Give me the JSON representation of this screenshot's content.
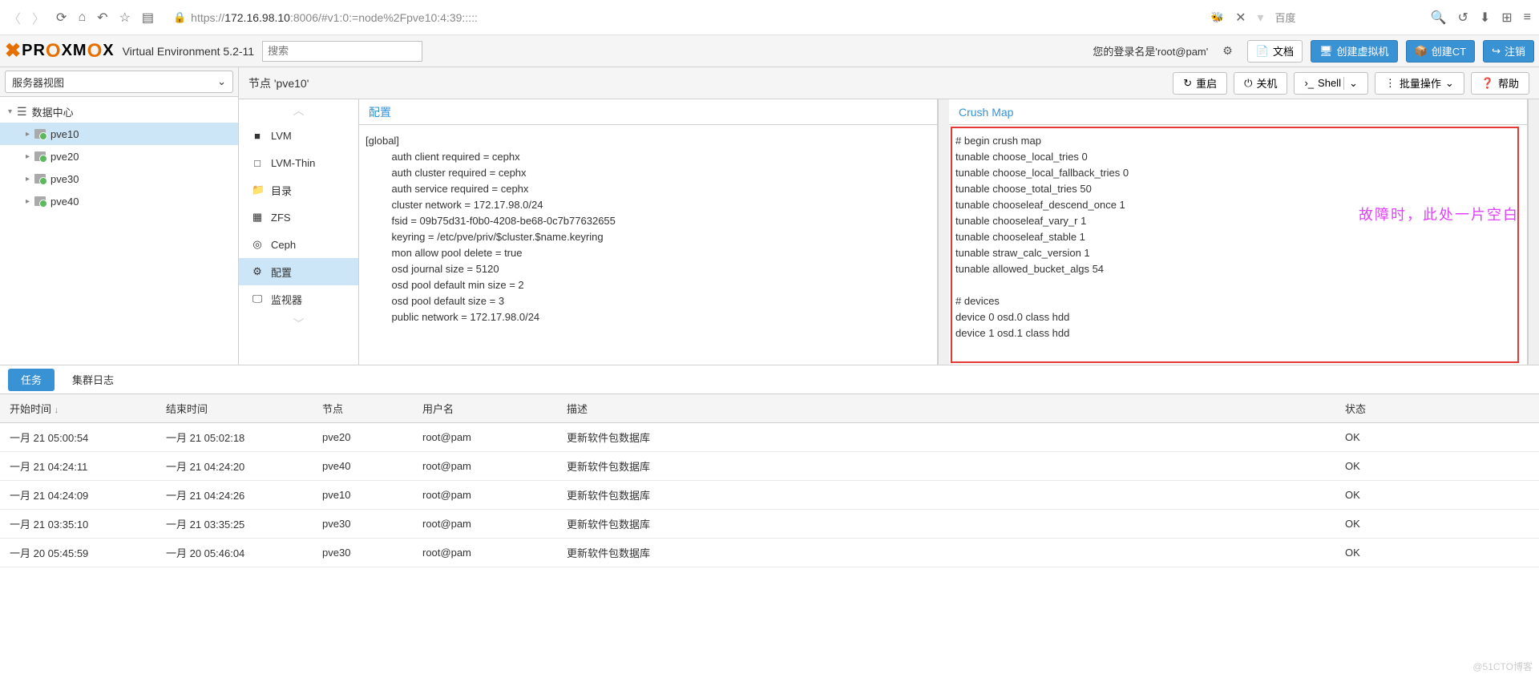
{
  "browser": {
    "url_scheme": "https://",
    "url_host": "172.16.98.10",
    "url_port": ":8006",
    "url_path": "/#v1:0:=node%2Fpve10:4:39:::::",
    "search_engine": "百度"
  },
  "header": {
    "logo_pre": "PR",
    "logo_o1": "O",
    "logo_mid": "XM",
    "logo_o2": "O",
    "logo_end": "X",
    "version": "Virtual Environment 5.2-11",
    "search_placeholder": "搜索",
    "login": "您的登录名是'root@pam'",
    "docs": "文档",
    "create_vm": "创建虚拟机",
    "create_ct": "创建CT",
    "logout": "注销"
  },
  "tree": {
    "view_label": "服务器视图",
    "root": "数据中心",
    "nodes": [
      "pve10",
      "pve20",
      "pve30",
      "pve40"
    ],
    "selected": "pve10"
  },
  "node": {
    "title": "节点 'pve10'",
    "btn_restart": "重启",
    "btn_shutdown": "关机",
    "btn_shell": "Shell",
    "btn_bulk": "批量操作",
    "btn_help": "帮助"
  },
  "subnav": {
    "items": [
      {
        "icon": "■",
        "label": "LVM"
      },
      {
        "icon": "□",
        "label": "LVM-Thin"
      },
      {
        "icon": "📁",
        "label": "目录"
      },
      {
        "icon": "▦",
        "label": "ZFS"
      },
      {
        "icon": "◎",
        "label": "Ceph",
        "group": true
      },
      {
        "icon": "⚙",
        "label": "配置",
        "selected": true
      },
      {
        "icon": "🖵",
        "label": "监视器"
      }
    ]
  },
  "config_panel": {
    "title": "配置",
    "text": "[global]\n         auth client required = cephx\n         auth cluster required = cephx\n         auth service required = cephx\n         cluster network = 172.17.98.0/24\n         fsid = 09b75d31-f0b0-4208-be68-0c7b77632655\n         keyring = /etc/pve/priv/$cluster.$name.keyring\n         mon allow pool delete = true\n         osd journal size = 5120\n         osd pool default min size = 2\n         osd pool default size = 3\n         public network = 172.17.98.0/24"
  },
  "crush_panel": {
    "title": "Crush Map",
    "text": "# begin crush map\ntunable choose_local_tries 0\ntunable choose_local_fallback_tries 0\ntunable choose_total_tries 50\ntunable chooseleaf_descend_once 1\ntunable chooseleaf_vary_r 1\ntunable chooseleaf_stable 1\ntunable straw_calc_version 1\ntunable allowed_bucket_algs 54\n\n# devices\ndevice 0 osd.0 class hdd\ndevice 1 osd.1 class hdd",
    "annotation": "故障时，此处一片空白"
  },
  "tasks": {
    "tab_tasks": "任务",
    "tab_log": "集群日志",
    "cols": {
      "start": "开始时间",
      "end": "结束时间",
      "node": "节点",
      "user": "用户名",
      "desc": "描述",
      "status": "状态"
    },
    "rows": [
      {
        "start": "一月 21 05:00:54",
        "end": "一月 21 05:02:18",
        "node": "pve20",
        "user": "root@pam",
        "desc": "更新软件包数据库",
        "status": "OK"
      },
      {
        "start": "一月 21 04:24:11",
        "end": "一月 21 04:24:20",
        "node": "pve40",
        "user": "root@pam",
        "desc": "更新软件包数据库",
        "status": "OK"
      },
      {
        "start": "一月 21 04:24:09",
        "end": "一月 21 04:24:26",
        "node": "pve10",
        "user": "root@pam",
        "desc": "更新软件包数据库",
        "status": "OK"
      },
      {
        "start": "一月 21 03:35:10",
        "end": "一月 21 03:35:25",
        "node": "pve30",
        "user": "root@pam",
        "desc": "更新软件包数据库",
        "status": "OK"
      },
      {
        "start": "一月 20 05:45:59",
        "end": "一月 20 05:46:04",
        "node": "pve30",
        "user": "root@pam",
        "desc": "更新软件包数据库",
        "status": "OK"
      }
    ]
  },
  "watermark": "@51CTO博客"
}
